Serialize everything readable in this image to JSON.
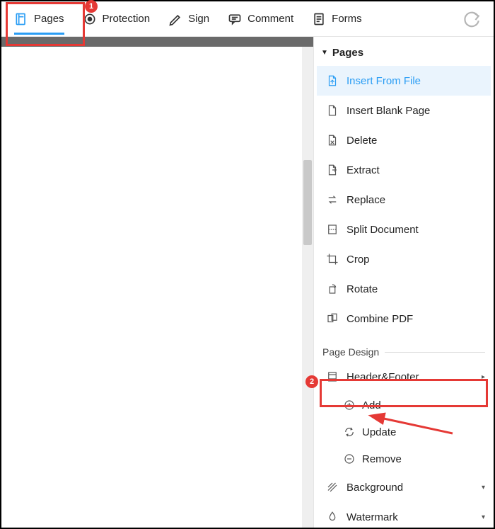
{
  "toolbar": {
    "pages": "Pages",
    "protection": "Protection",
    "sign": "Sign",
    "comment": "Comment",
    "forms": "Forms"
  },
  "panel": {
    "title": "Pages",
    "items": {
      "insert_from_file": "Insert From File",
      "insert_blank_page": "Insert Blank Page",
      "delete": "Delete",
      "extract": "Extract",
      "replace": "Replace",
      "split_document": "Split Document",
      "crop": "Crop",
      "rotate": "Rotate",
      "combine_pdf": "Combine PDF"
    },
    "section": "Page Design",
    "header_footer": "Header&Footer",
    "hf_sub": {
      "add": "Add",
      "update": "Update",
      "remove": "Remove"
    },
    "background": "Background",
    "watermark": "Watermark"
  },
  "annotations": {
    "badge1": "1",
    "badge2": "2"
  }
}
